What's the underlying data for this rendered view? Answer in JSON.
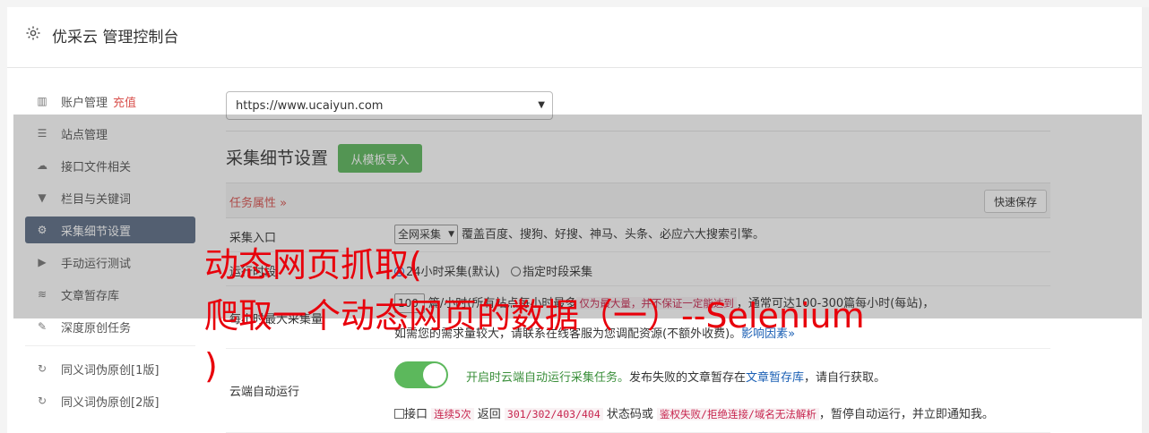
{
  "header": {
    "title": "优采云 管理控制台"
  },
  "sidebar": {
    "items": [
      {
        "label": "账户管理",
        "badge": "充值",
        "icon": "bar-chart-icon"
      },
      {
        "label": "站点管理",
        "icon": "server-icon"
      },
      {
        "label": "接口文件相关",
        "icon": "cloud-upload-icon"
      },
      {
        "label": "栏目与关键词",
        "icon": "filter-icon"
      },
      {
        "label": "采集细节设置",
        "icon": "gears-icon",
        "active": true
      },
      {
        "label": "手动运行测试",
        "icon": "play-circle-icon"
      },
      {
        "label": "文章暂存库",
        "icon": "database-icon"
      },
      {
        "label": "深度原创任务",
        "icon": "edit-icon"
      },
      {
        "label": "同义词伪原创[1版]",
        "icon": "refresh-icon"
      },
      {
        "label": "同义词伪原创[2版]",
        "icon": "refresh-icon"
      }
    ]
  },
  "site_select": {
    "value": "https://www.ucaiyun.com"
  },
  "section": {
    "title": "采集细节设置",
    "template_btn": "从模板导入"
  },
  "attr_bar": {
    "label": "任务属性 »",
    "save_btn": "快速保存"
  },
  "rows": {
    "entry": {
      "label": "采集入口",
      "select": "全网采集",
      "desc": "覆盖百度、搜狗、好搜、神马、头条、必应六大搜索引擎。"
    },
    "time": {
      "label": "运行时段",
      "opt1": "24小时采集(默认)",
      "opt2": "指定时段采集"
    },
    "max": {
      "label": "每小时最大采集量",
      "input_value": "100",
      "desc_a": "篇/小时(所有站点每小时最多",
      "desc_hl": "仅为最大量，并不保证一定能达到",
      "desc_b": "，通常可达100-300篇每小时(每站)，",
      "desc_c": "如需您的需求量较大，请联系在线客服为您调配资源(不额外收费)。",
      "link": "影响因素»"
    },
    "cloud": {
      "label": "云端自动运行",
      "desc_green": "开启时云端自动运行采集任务。",
      "desc_a": "发布失败的文章暂存在",
      "desc_link": "文章暂存库",
      "desc_b": "，请自行获取。",
      "chk_a": "接口",
      "chk_hl1": "连续5次",
      "chk_b": "返回",
      "chk_hl2": "301/302/403/404",
      "chk_c": "状态码或",
      "chk_hl3": "鉴权失败/拒绝连接/域名无法解析",
      "chk_d": "，暂停自动运行，并立即通知我。"
    }
  },
  "caption": {
    "line1": "动态网页抓取(",
    "line2": "爬取一个动态网页的数据（一）--Selenium",
    "line3": ")"
  },
  "colors": {
    "accent_green": "#5cb85c",
    "active_nav": "#5c6d86",
    "caption_red": "#e8000b"
  }
}
